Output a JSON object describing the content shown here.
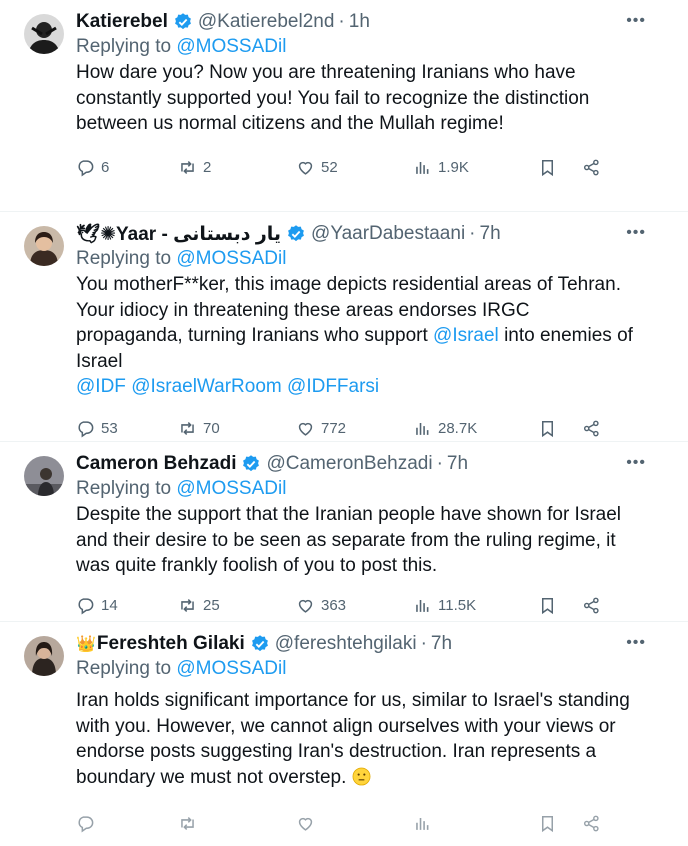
{
  "replying_to_label": "Replying to",
  "tweets": [
    {
      "name": "Katierebel",
      "handle": "@Katierebel2nd",
      "time": "1h",
      "replying_to": "@MOSSADil",
      "text": "How dare you? Now you are threatening Iranians who have constantly supported you! You fail to recognize the distinction between us normal citizens and the Mullah regime!",
      "replies": "6",
      "retweets": "2",
      "likes": "52",
      "views": "1.9K"
    },
    {
      "name_prefix": "🕊✺Yaar - یار دبستانی",
      "handle": "@YaarDabestaani",
      "time": "7h",
      "replying_to": "@MOSSADil",
      "text_1": "You motherF**ker, this image depicts residential areas of Tehran. Your idiocy in threatening these areas endorses IRGC propaganda, turning Iranians who support",
      "mention_israel": "@Israel",
      "text_2": "into enemies of Israel",
      "mentions_line": [
        "@IDF",
        "@IsraelWarRoom",
        "@IDFFarsi"
      ],
      "replies": "53",
      "retweets": "70",
      "likes": "772",
      "views": "28.7K"
    },
    {
      "name": "Cameron Behzadi",
      "handle": "@CameronBehzadi",
      "time": "7h",
      "replying_to": "@MOSSADil",
      "text": "Despite the support that the Iranian people have shown for Israel and their desire to be seen as separate from the ruling regime, it was quite frankly foolish of you to post this.",
      "replies": "14",
      "retweets": "25",
      "likes": "363",
      "views": "11.5K"
    },
    {
      "name": "Fereshteh Gilaki",
      "crown": "👑",
      "handle": "@fereshtehgilaki",
      "time": "7h",
      "replying_to": "@MOSSADil",
      "text": "Iran holds significant importance for us, similar to Israel's standing with you. However, we cannot align ourselves with your views or endorse posts suggesting Iran's destruction. Iran represents a boundary we must not overstep."
    }
  ],
  "colors": {
    "accent": "#1d9bf0",
    "muted": "#536471",
    "text": "#0f1419",
    "divider": "#eff3f4"
  },
  "icons": [
    "avatar",
    "verified-badge-icon",
    "more-options-icon",
    "reply-icon",
    "retweet-icon",
    "like-icon",
    "views-icon",
    "bookmark-icon",
    "share-icon",
    "emoji-icon"
  ]
}
